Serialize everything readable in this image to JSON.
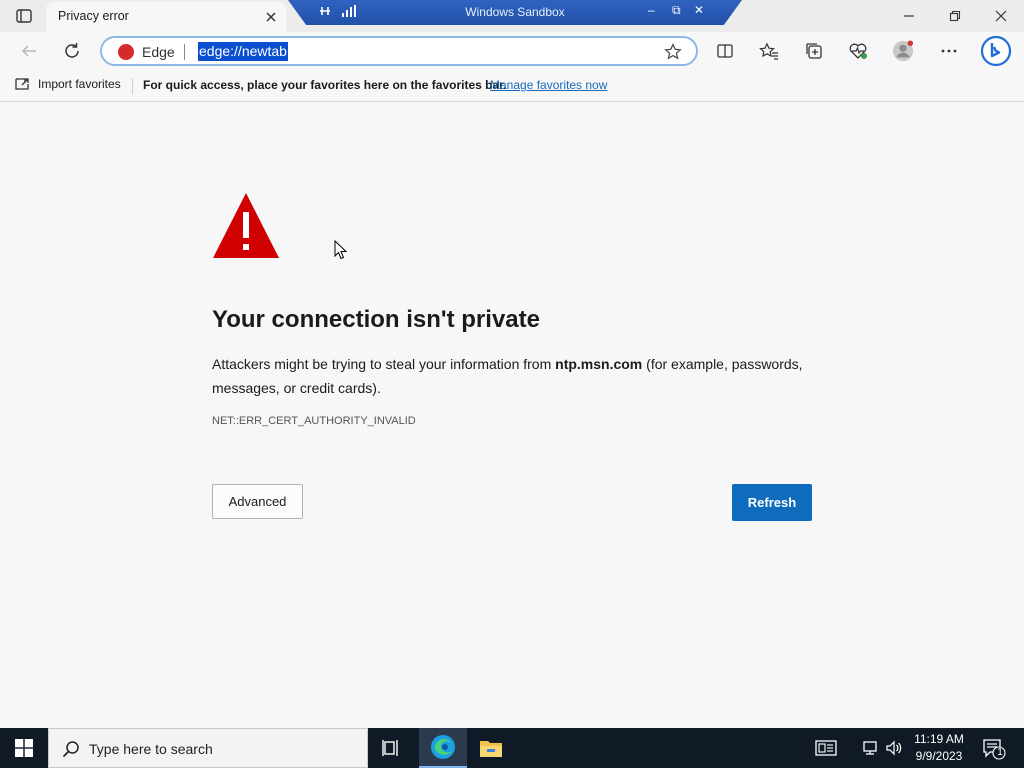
{
  "browser": {
    "tab": {
      "title": "Privacy error"
    },
    "sandbox": {
      "title": "Windows Sandbox"
    },
    "omnibox": {
      "scheme_label": "Edge",
      "url": "edge://newtab"
    },
    "favorites_bar": {
      "import_label": "Import favorites",
      "message": "For quick access, place your favorites here on the favorites bar.",
      "manage_link": "Manage favorites now"
    }
  },
  "error_page": {
    "title": "Your connection isn't private",
    "body_prefix": "Attackers might be trying to steal your information from ",
    "host": "ntp.msn.com",
    "body_suffix": " (for example, passwords, messages, or credit cards).",
    "error_code": "NET::ERR_CERT_AUTHORITY_INVALID",
    "advanced_label": "Advanced",
    "refresh_label": "Refresh"
  },
  "taskbar": {
    "search_placeholder": "Type here to search",
    "time": "11:19 AM",
    "date": "9/9/2023",
    "notification_count": "1"
  },
  "colors": {
    "accent": "#0f6cbd",
    "warning_red": "#d00000",
    "link": "#1a6bbd",
    "taskbar": "#101a26"
  }
}
